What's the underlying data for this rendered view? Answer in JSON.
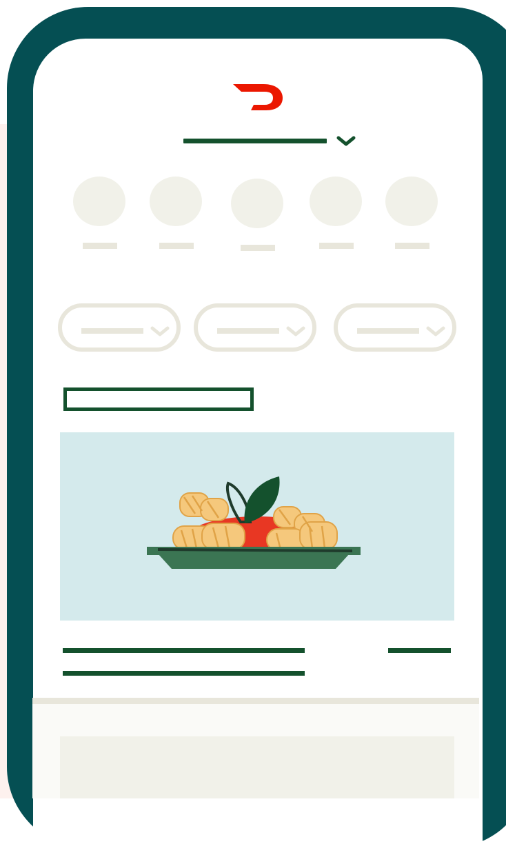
{
  "colors": {
    "phone_frame": "#054f53",
    "brand_accent": "#eb1700",
    "primary_line": "#14512d",
    "placeholder": "#e8e6db",
    "card_image_bg": "#d4eaec"
  },
  "icons": {
    "logo": "doordash-logo-icon",
    "address_toggle": "chevron-down-icon",
    "filter_toggle": "chevron-down-icon",
    "food": "pasta-dish-illustration"
  },
  "categories": [
    {},
    {},
    {},
    {},
    {}
  ],
  "filters": [
    {},
    {},
    {}
  ]
}
